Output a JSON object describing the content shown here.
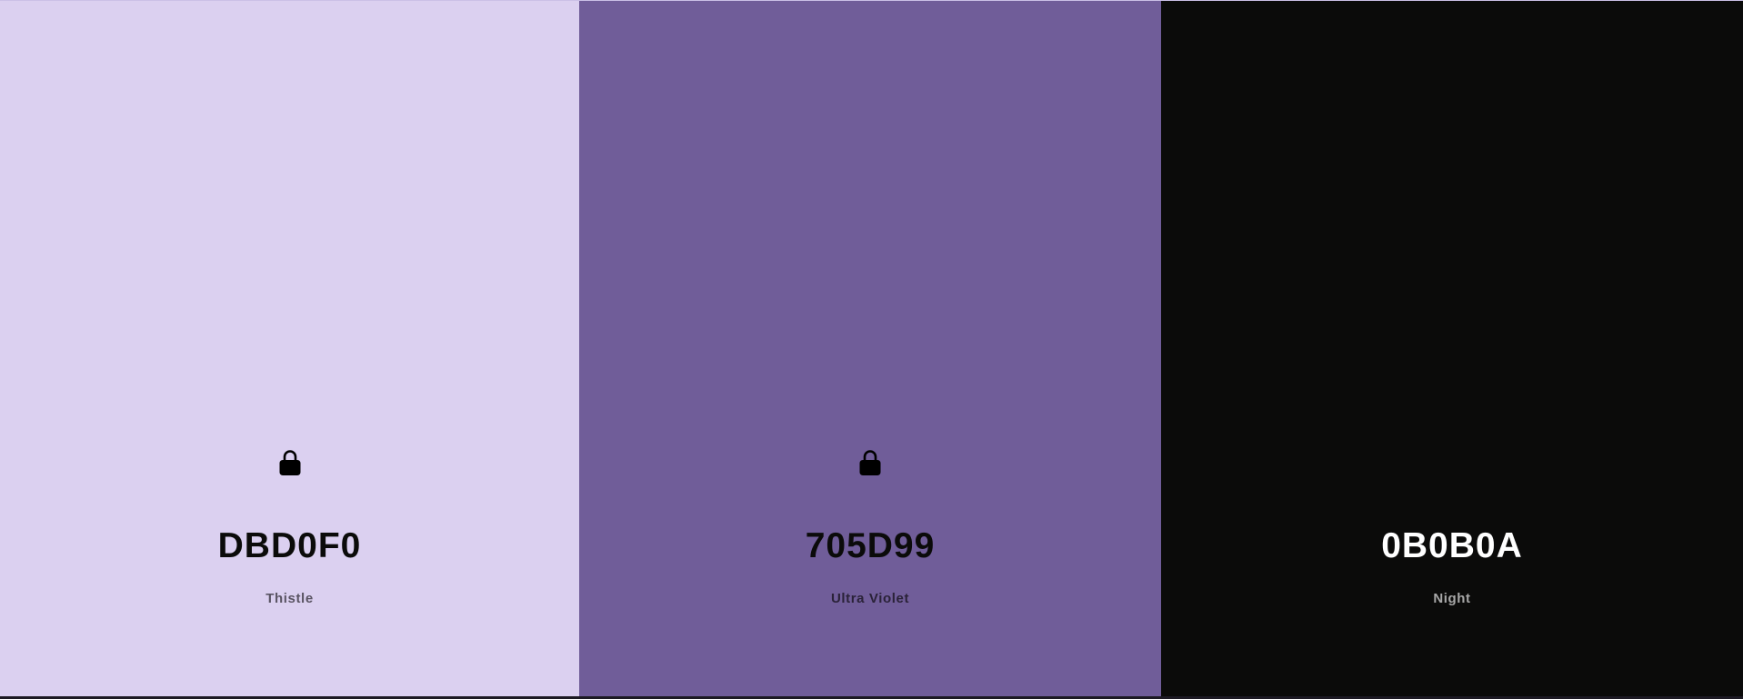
{
  "swatches": [
    {
      "hex": "DBD0F0",
      "name": "Thistle",
      "bg": "#DBD0F0",
      "hex_color": "#0b0b0a",
      "name_color": "#5a5463",
      "lock_color": "#000000",
      "locked": true,
      "icon": "lock-icon"
    },
    {
      "hex": "705D99",
      "name": "Ultra Violet",
      "bg": "#705D99",
      "hex_color": "#0b0b0a",
      "name_color": "#2a2238",
      "lock_color": "#000000",
      "locked": true,
      "icon": "lock-icon"
    },
    {
      "hex": "0B0B0A",
      "name": "Night",
      "bg": "#0B0B0A",
      "hex_color": "#ffffff",
      "name_color": "#a8a8a8",
      "locked": false
    }
  ]
}
